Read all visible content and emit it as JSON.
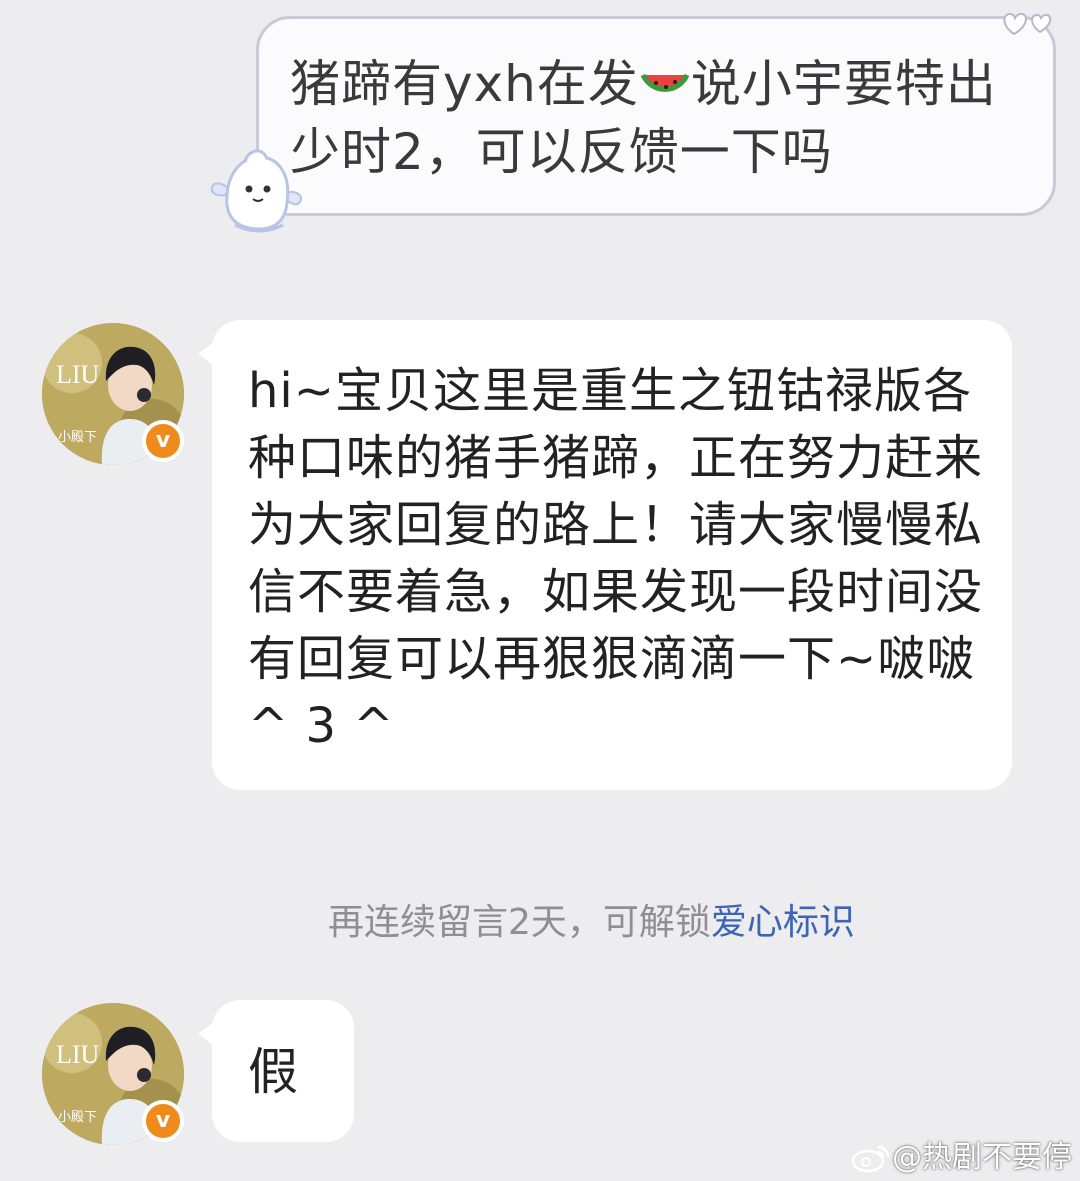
{
  "messages": [
    {
      "direction": "outgoing",
      "text_before_emoji": "猪蹄有yxh在发",
      "emoji": "watermelon-icon",
      "text_after_emoji": "说小宇要特出少时2，可以反馈一下吗"
    },
    {
      "direction": "incoming",
      "sender_verified": true,
      "text": "hi~宝贝这里是重生之钮钴禄版各种口味的猪手猪蹄，正在努力赶来为大家回复的路上！请大家慢慢私信不要着急，如果发现一段时间没有回复可以再狠狠滴滴一下~啵啵 ^ 3 ^"
    },
    {
      "direction": "incoming",
      "sender_verified": true,
      "text": "假"
    }
  ],
  "system_notice": {
    "text": "再连续留言2天，可解锁",
    "link": "爱心标识"
  },
  "avatar": {
    "badge": "v",
    "text_overlay": "LIU",
    "caption": "小殿下"
  },
  "watermark": {
    "logo": "weibo-logo",
    "text": "@热剧不要停"
  },
  "colors": {
    "background": "#ededef",
    "outgoing_border": "#c9c9d9",
    "badge": "#f08a1c",
    "link": "#3e65b3"
  }
}
